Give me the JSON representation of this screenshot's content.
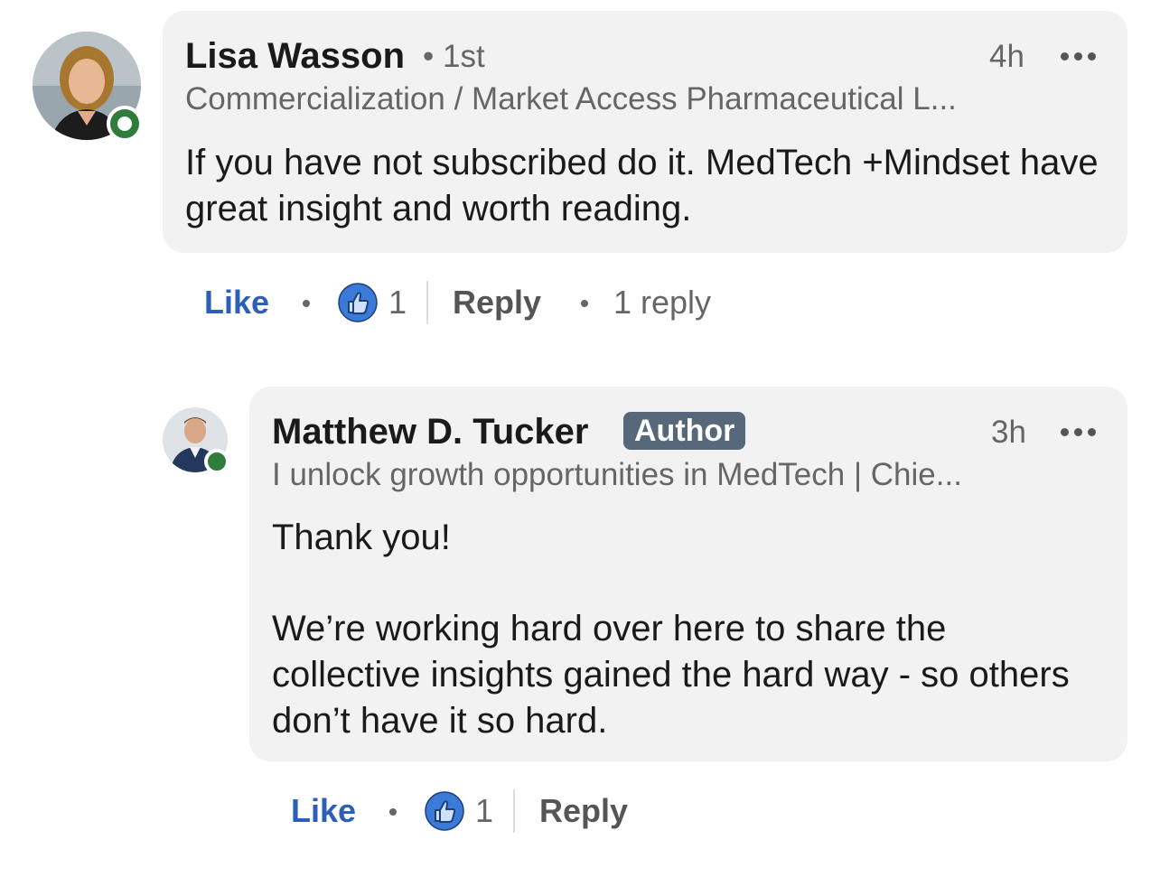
{
  "comments": [
    {
      "author": "Lisa Wasson",
      "degree": "• 1st",
      "time": "4h",
      "headline": "Commercialization / Market Access Pharmaceutical L...",
      "text": "If you have not subscribed do it. MedTech +Mindset have great insight and worth reading.",
      "actions": {
        "like_label": "Like",
        "reaction_count": "1",
        "reply_label": "Reply",
        "replies": "1 reply"
      }
    },
    {
      "author": "Matthew D. Tucker",
      "badge": "Author",
      "time": "3h",
      "headline": "I unlock growth opportunities in MedTech | Chie...",
      "text_line1": "Thank you!",
      "text_line2": "We’re working hard over here to share the collective insights gained the hard way - so others don’t have it so hard.",
      "actions": {
        "like_label": "Like",
        "reaction_count": "1",
        "reply_label": "Reply"
      }
    }
  ],
  "colors": {
    "bubble": "#f2f2f2",
    "like": "#2d5fb8",
    "presence": "#2e7d3a",
    "badge": "#56687a"
  },
  "icons": {
    "more": "more-horizontal-icon",
    "reaction": "thumbs-up-icon"
  }
}
